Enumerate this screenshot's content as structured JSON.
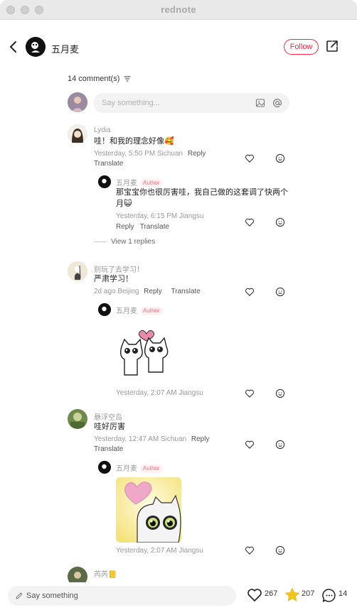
{
  "window": {
    "title": "rednote"
  },
  "header": {
    "author_name": "五月麦",
    "follow_label": "Follow"
  },
  "comments_header": {
    "count_label": "14 comment(s)"
  },
  "composer": {
    "placeholder": "Say something..."
  },
  "comments": [
    {
      "name": "Lydia",
      "text": "哇！和我的理念好像🥰",
      "meta": "Yesterday, 5:50 PM Sichuan",
      "reply_label": "Reply",
      "translate_label": "Translate",
      "replies": [
        {
          "name": "五月麦",
          "tag": "Author",
          "text_line1": "那宝宝你也很厉害哇，我自己做的这套调了快两个",
          "text_line2": "月😺",
          "meta": "Yesterday, 6:15 PM Jiangsu",
          "reply_label": "Reply",
          "translate_label": "Translate"
        }
      ],
      "view_replies_label": "View 1 replies"
    },
    {
      "name": "别玩了去学习！",
      "text": "严肃学习！",
      "meta": "2d ago Beijing",
      "reply_label": "Reply",
      "translate_label": "Translate",
      "replies": [
        {
          "name": "五月麦",
          "tag": "Author",
          "meta": "Yesterday, 2:07 AM Jiangsu"
        }
      ]
    },
    {
      "name": "悬浮空岛",
      "text": "哇好厉害",
      "meta": "Yesterday, 12:47 AM Sichuan",
      "reply_label": "Reply",
      "translate_label": "Translate",
      "replies": [
        {
          "name": "五月麦",
          "tag": "Author",
          "meta": "Yesterday, 2:07 AM Jiangsu"
        }
      ]
    },
    {
      "name": "芮芮📒"
    }
  ],
  "bottom_bar": {
    "say_label": "Say something",
    "likes": "267",
    "stars": "207",
    "comments": "14"
  },
  "colors": {
    "accent": "#ff2442",
    "author_tag": "#ff6b82",
    "star": "#f5c518"
  }
}
